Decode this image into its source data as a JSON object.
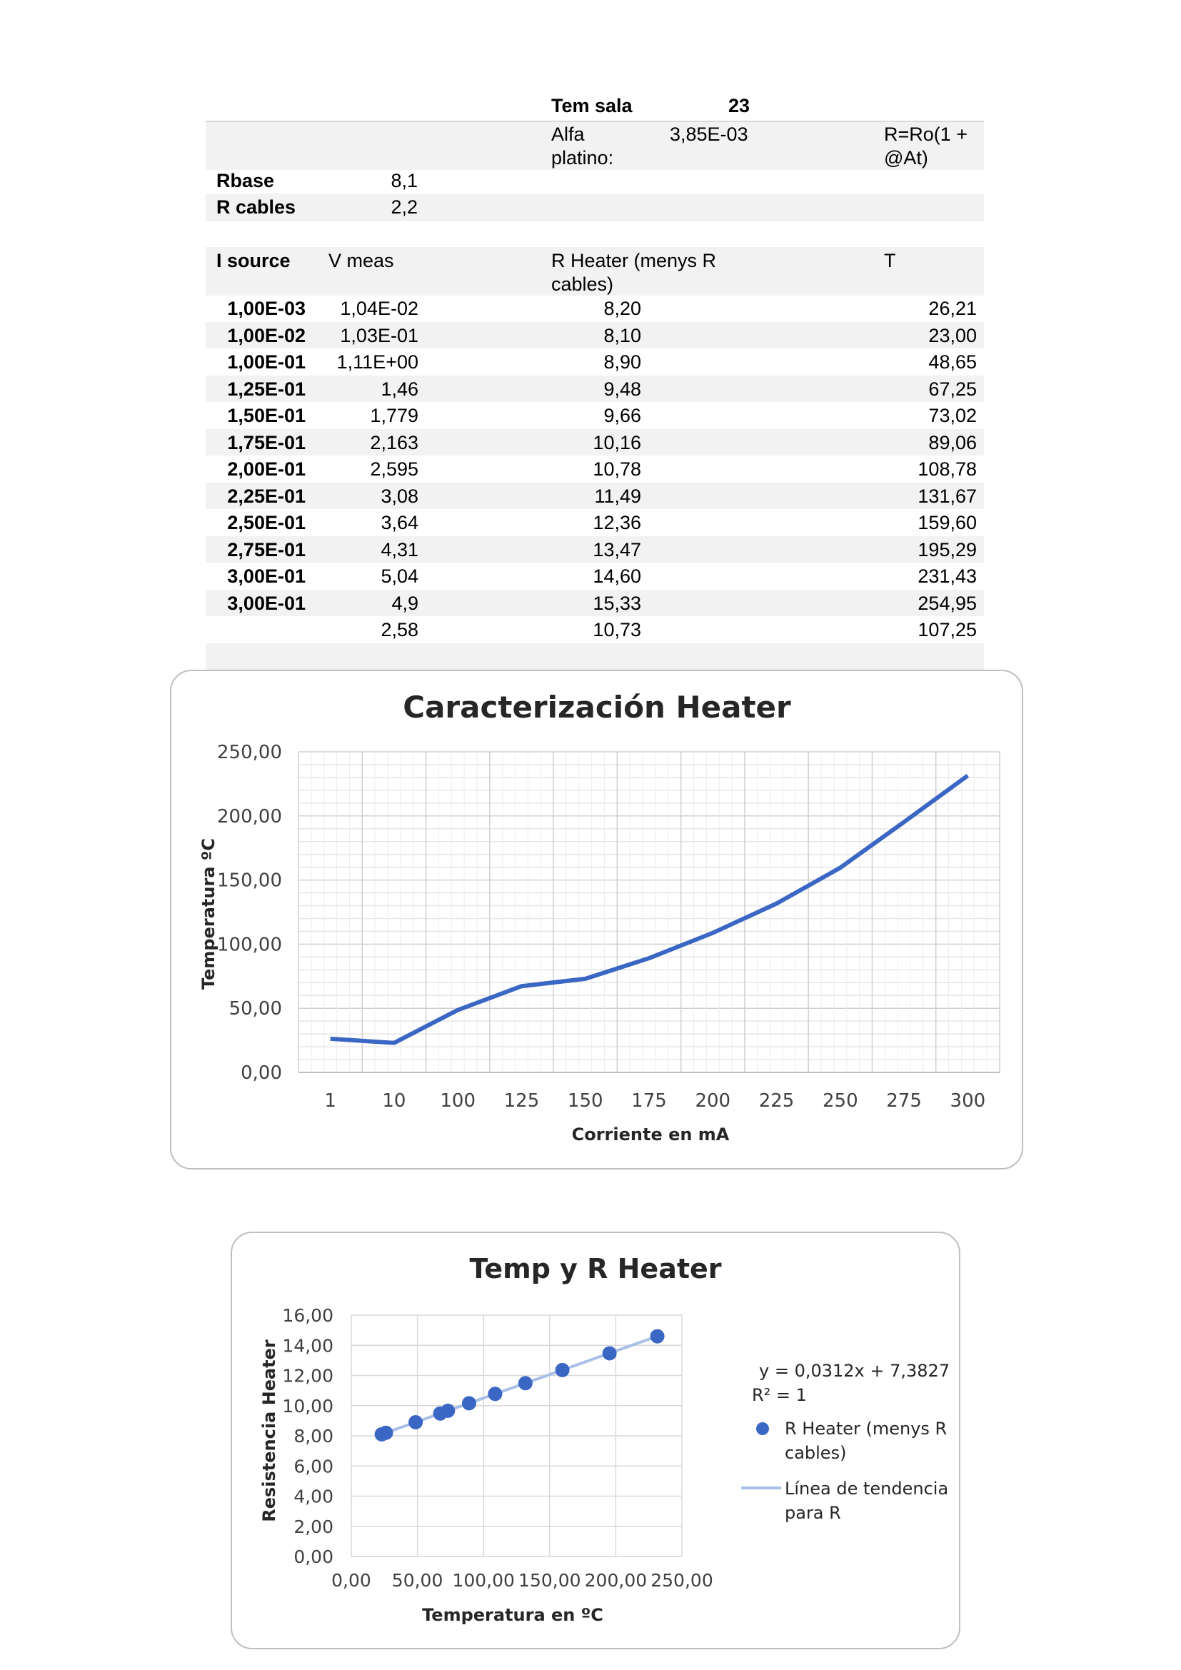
{
  "header": {
    "tem_sala_label": "Tem sala",
    "tem_sala_value": "23",
    "alfa_label_1": "Alfa",
    "alfa_label_2": "platino:",
    "alfa_value": "3,85E-03",
    "formula_1": "R=Ro(1 +",
    "formula_2": "@At)",
    "rbase_label": "Rbase",
    "rbase_value": "8,1",
    "rcables_label": "R cables",
    "rcables_value": "2,2"
  },
  "table": {
    "headers": {
      "i_source": "I source",
      "v_meas": "V meas",
      "r_heater_1": "R Heater (menys R",
      "r_heater_2": "cables)",
      "t": "T"
    },
    "rows": [
      {
        "i": "1,00E-03",
        "v": "1,04E-02",
        "r": "8,20",
        "t": "26,21"
      },
      {
        "i": "1,00E-02",
        "v": "1,03E-01",
        "r": "8,10",
        "t": "23,00"
      },
      {
        "i": "1,00E-01",
        "v": "1,11E+00",
        "r": "8,90",
        "t": "48,65"
      },
      {
        "i": "1,25E-01",
        "v": "1,46",
        "r": "9,48",
        "t": "67,25"
      },
      {
        "i": "1,50E-01",
        "v": "1,779",
        "r": "9,66",
        "t": "73,02"
      },
      {
        "i": "1,75E-01",
        "v": "2,163",
        "r": "10,16",
        "t": "89,06"
      },
      {
        "i": "2,00E-01",
        "v": "2,595",
        "r": "10,78",
        "t": "108,78"
      },
      {
        "i": "2,25E-01",
        "v": "3,08",
        "r": "11,49",
        "t": "131,67"
      },
      {
        "i": "2,50E-01",
        "v": "3,64",
        "r": "12,36",
        "t": "159,60"
      },
      {
        "i": "2,75E-01",
        "v": "4,31",
        "r": "13,47",
        "t": "195,29"
      },
      {
        "i": "3,00E-01",
        "v": "5,04",
        "r": "14,60",
        "t": "231,43"
      },
      {
        "i": "3,00E-01",
        "v": "4,9",
        "r": "15,33",
        "t": "254,95"
      },
      {
        "i": "",
        "v": "2,58",
        "r": "10,73",
        "t": "107,25"
      }
    ]
  },
  "chart_data": [
    {
      "type": "line",
      "title": "Caracterización Heater",
      "xlabel": "Corriente en mA",
      "ylabel": "Temperatura ºC",
      "categories": [
        "1",
        "10",
        "100",
        "125",
        "150",
        "175",
        "200",
        "225",
        "250",
        "275",
        "300"
      ],
      "series": [
        {
          "values": [
            26.21,
            23.0,
            48.65,
            67.25,
            73.02,
            89.06,
            108.78,
            131.67,
            159.6,
            195.29,
            231.43
          ]
        }
      ],
      "ylim": [
        0,
        250
      ],
      "yticks": [
        "0,00",
        "50,00",
        "100,00",
        "150,00",
        "200,00",
        "250,00"
      ],
      "grid": true,
      "color": "#3a66c4"
    },
    {
      "type": "scatter",
      "title": "Temp y R Heater",
      "xlabel": "Temperatura en ºC",
      "ylabel": "Resistencia Heater",
      "xlim": [
        0,
        250
      ],
      "ylim": [
        0,
        16
      ],
      "xticks": [
        "0,00",
        "50,00",
        "100,00",
        "150,00",
        "200,00",
        "250,00"
      ],
      "yticks": [
        "0,00",
        "2,00",
        "4,00",
        "6,00",
        "8,00",
        "10,00",
        "12,00",
        "14,00",
        "16,00"
      ],
      "grid": true,
      "series": [
        {
          "name": "R Heater (menys R cables)",
          "x": [
            26.21,
            23.0,
            48.65,
            67.25,
            73.02,
            89.06,
            108.78,
            131.67,
            159.6,
            195.29,
            231.43
          ],
          "y": [
            8.2,
            8.1,
            8.9,
            9.48,
            9.66,
            10.16,
            10.78,
            11.49,
            12.36,
            13.47,
            14.6
          ],
          "color": "#3a66c4"
        }
      ],
      "trendline": {
        "name": "Línea de tendencia para R",
        "slope": 0.0312,
        "intercept": 7.3827,
        "equation": "y = 0,0312x + 7,3827",
        "r2": "R² = 1",
        "color": "#a9c0e6"
      },
      "legend_items": [
        "R Heater (menys R",
        "cables)",
        "Línea de tendencia",
        "para R"
      ],
      "legend": "right"
    }
  ]
}
